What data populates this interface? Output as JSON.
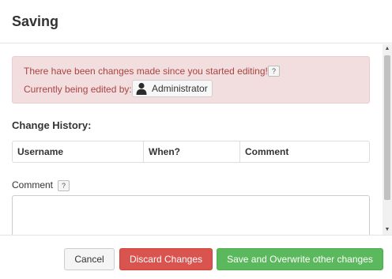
{
  "dialog": {
    "title": "Saving"
  },
  "alert": {
    "message": "There have been changes made since you started editing!",
    "help_glyph": "?",
    "editing_label": "Currently being edited by:",
    "editing_user": "Administrator",
    "colors": {
      "background": "#f2dede",
      "text": "#a94442"
    }
  },
  "history": {
    "title": "Change History:",
    "columns": [
      "Username",
      "When?",
      "Comment"
    ],
    "rows": []
  },
  "comment": {
    "label": "Comment",
    "help_glyph": "?",
    "value": ""
  },
  "scrollbar": {
    "up_glyph": "▲",
    "down_glyph": "▼"
  },
  "footer": {
    "cancel_label": "Cancel",
    "discard_label": "Discard Changes",
    "save_label": "Save and Overwrite other changes",
    "colors": {
      "discard": "#d9534f",
      "save": "#5cb85c"
    }
  },
  "icons": {
    "user": "user-icon",
    "help": "question-mark-icon"
  }
}
